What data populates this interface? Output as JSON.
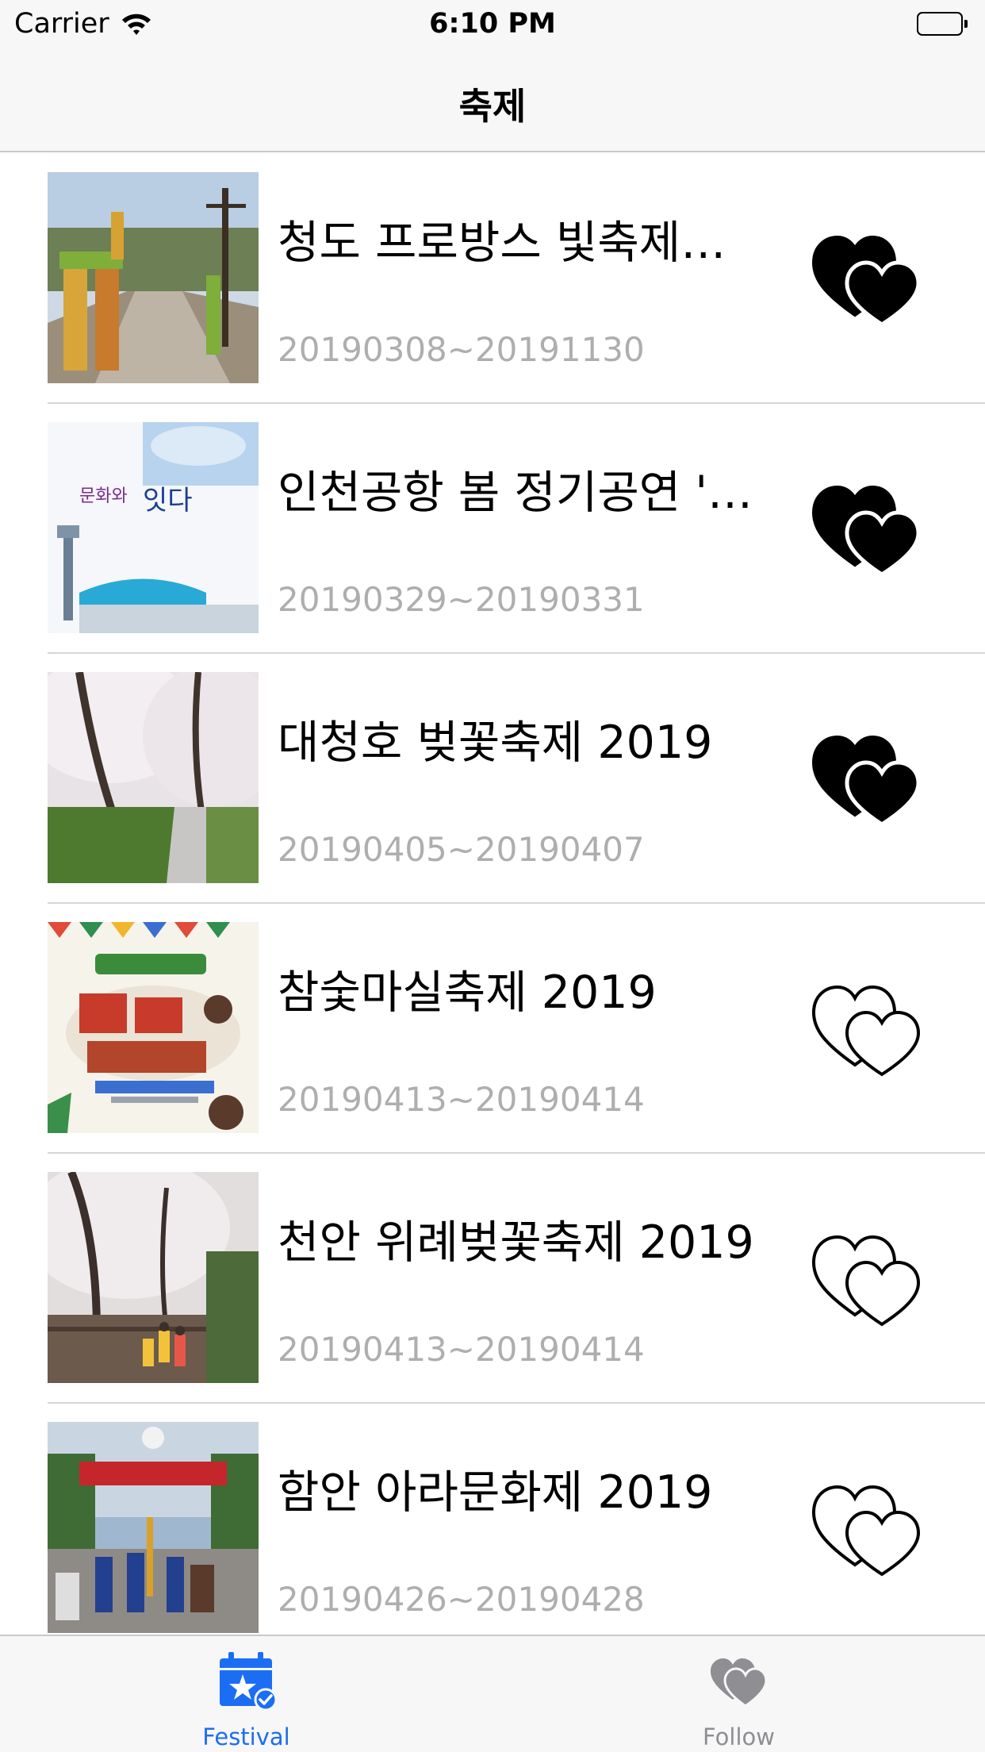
{
  "status_bar": {
    "carrier": "Carrier",
    "time": "6:10 PM",
    "wifi_icon": "wifi-icon",
    "battery_icon": "battery-icon"
  },
  "nav": {
    "title": "축제"
  },
  "festivals": [
    {
      "title": "청도 프로방스 빛축제와...",
      "date": "20190308~20191130",
      "favorited": true
    },
    {
      "title": "인천공항 봄 정기공연 'H...",
      "date": "20190329~20190331",
      "favorited": true
    },
    {
      "title": "대청호 벚꽃축제 2019",
      "date": "20190405~20190407",
      "favorited": true
    },
    {
      "title": "참숯마실축제 2019",
      "date": "20190413~20190414",
      "favorited": false
    },
    {
      "title": "천안 위례벚꽃축제 2019",
      "date": "20190413~20190414",
      "favorited": false
    },
    {
      "title": "함안 아라문화제 2019",
      "date": "20190426~20190428",
      "favorited": false
    }
  ],
  "tab_bar": {
    "tabs": [
      {
        "label": "Festival",
        "icon": "calendar-star-icon",
        "selected": true
      },
      {
        "label": "Follow",
        "icon": "hearts-icon",
        "selected": false
      }
    ]
  },
  "colors": {
    "accent": "#1b6ef3",
    "inactive_tab": "#8e8e93",
    "date_text": "#aeaeae",
    "bar_background": "#f7f7f7"
  }
}
